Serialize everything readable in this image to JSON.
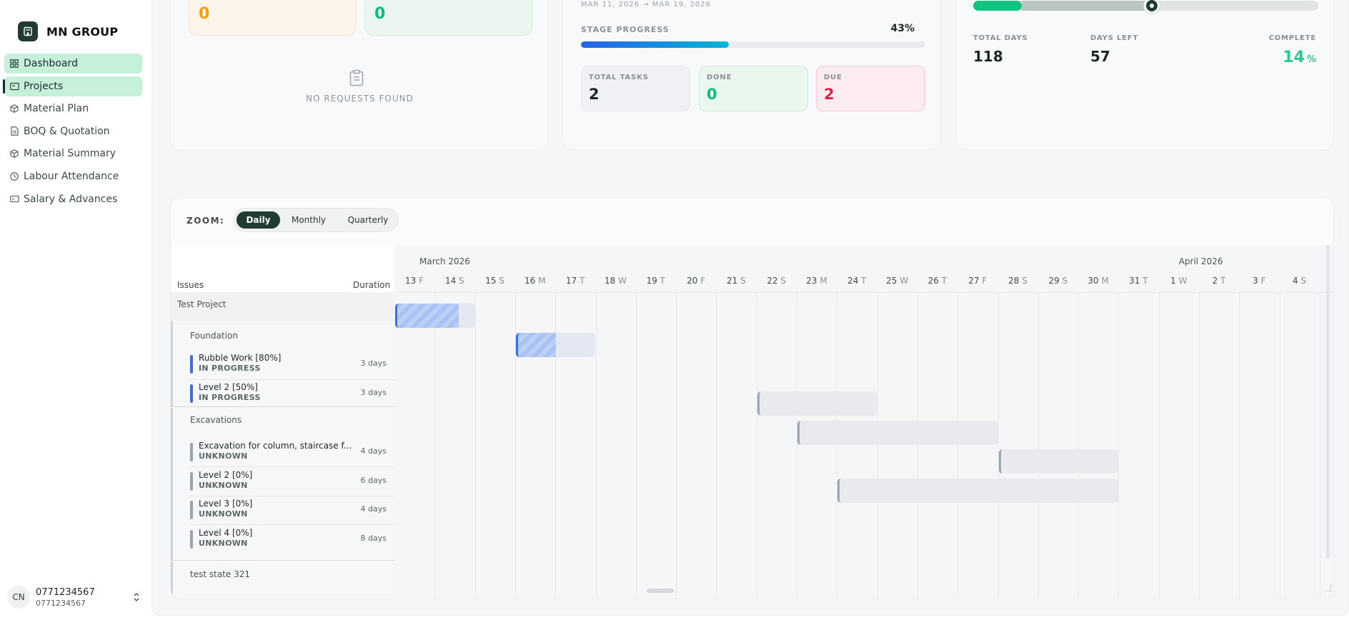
{
  "brand": {
    "title": "MN GROUP"
  },
  "sidebar": {
    "items": [
      {
        "label": "Dashboard",
        "icon": "dashboard-icon"
      },
      {
        "label": "Projects",
        "icon": "folder-icon"
      },
      {
        "label": "Material Plan",
        "icon": "box-icon"
      },
      {
        "label": "BOQ & Quotation",
        "icon": "document-icon"
      },
      {
        "label": "Material Summary",
        "icon": "box-icon"
      },
      {
        "label": "Labour Attendance",
        "icon": "clock-icon"
      },
      {
        "label": "Salary & Advances",
        "icon": "wallet-icon"
      }
    ]
  },
  "user": {
    "initials": "CN",
    "name": "0771234567",
    "sub": "0771234567"
  },
  "requests": {
    "orange_value": "0",
    "green_value": "0",
    "empty_text": "NO REQUESTS FOUND"
  },
  "stage": {
    "date_range": "MAR 11, 2026 → MAR 19, 2026",
    "label": "STAGE PROGRESS",
    "percent_text": "43%",
    "percent": 43,
    "total_tasks_label": "TOTAL TASKS",
    "total_tasks": "2",
    "done_label": "DONE",
    "done": "0",
    "due_label": "DUE",
    "due": "2"
  },
  "timeline": {
    "total_days_label": "TOTAL DAYS",
    "total_days": "118",
    "days_left_label": "DAYS LEFT",
    "days_left": "57",
    "complete_label": "COMPLETE",
    "complete_value": "14",
    "complete_unit": "%"
  },
  "zoom": {
    "label": "ZOOM:",
    "options": [
      "Daily",
      "Monthly",
      "Quarterly"
    ],
    "selected": "Daily"
  },
  "gantt": {
    "columns": {
      "issues": "Issues",
      "duration": "Duration"
    },
    "months": [
      "March 2026",
      "April 2026"
    ],
    "days": [
      {
        "d": "13",
        "w": "F"
      },
      {
        "d": "14",
        "w": "S"
      },
      {
        "d": "15",
        "w": "S"
      },
      {
        "d": "16",
        "w": "M"
      },
      {
        "d": "17",
        "w": "T"
      },
      {
        "d": "18",
        "w": "W"
      },
      {
        "d": "19",
        "w": "T"
      },
      {
        "d": "20",
        "w": "F"
      },
      {
        "d": "21",
        "w": "S"
      },
      {
        "d": "22",
        "w": "S"
      },
      {
        "d": "23",
        "w": "M"
      },
      {
        "d": "24",
        "w": "T"
      },
      {
        "d": "25",
        "w": "W"
      },
      {
        "d": "26",
        "w": "T"
      },
      {
        "d": "27",
        "w": "F"
      },
      {
        "d": "28",
        "w": "S"
      },
      {
        "d": "29",
        "w": "S"
      },
      {
        "d": "30",
        "w": "M"
      },
      {
        "d": "31",
        "w": "T"
      },
      {
        "d": "1",
        "w": "W"
      },
      {
        "d": "2",
        "w": "T"
      },
      {
        "d": "3",
        "w": "F"
      },
      {
        "d": "4",
        "w": "S"
      }
    ],
    "project": "Test Project",
    "phases": [
      {
        "title": "Foundation",
        "tasks": [
          {
            "name": "Rubble Work [80%]",
            "status": "IN PROGRESS",
            "duration": "3 days",
            "start_index": 0,
            "length": 2,
            "progress": 0.8
          },
          {
            "name": "Level 2 [50%]",
            "status": "IN PROGRESS",
            "duration": "3 days",
            "start_index": 3,
            "length": 2,
            "progress": 0.5
          }
        ]
      },
      {
        "title": "Excavations",
        "tasks": [
          {
            "name": "Excavation for column, staircase f...",
            "status": "UNKNOWN",
            "duration": "4 days",
            "start_index": 9,
            "length": 3,
            "progress": 0
          },
          {
            "name": "Level 2 [0%]",
            "status": "UNKNOWN",
            "duration": "6 days",
            "start_index": 10,
            "length": 5,
            "progress": 0
          },
          {
            "name": "Level 3 [0%]",
            "status": "UNKNOWN",
            "duration": "4 days",
            "start_index": 15,
            "length": 3,
            "progress": 0
          },
          {
            "name": "Level 4 [0%]",
            "status": "UNKNOWN",
            "duration": "8 days",
            "start_index": 11,
            "length": 7,
            "progress": 0
          }
        ]
      }
    ],
    "footer_phase": "test state 321"
  },
  "colors": {
    "accent": "#1f3b33",
    "active_nav": "#c6f0da",
    "orange": "#f59e0b",
    "green": "#10b981",
    "red": "#e11d48",
    "in_progress_bar": "#3b6fe0",
    "unknown_bar": "#9aa3ae"
  }
}
